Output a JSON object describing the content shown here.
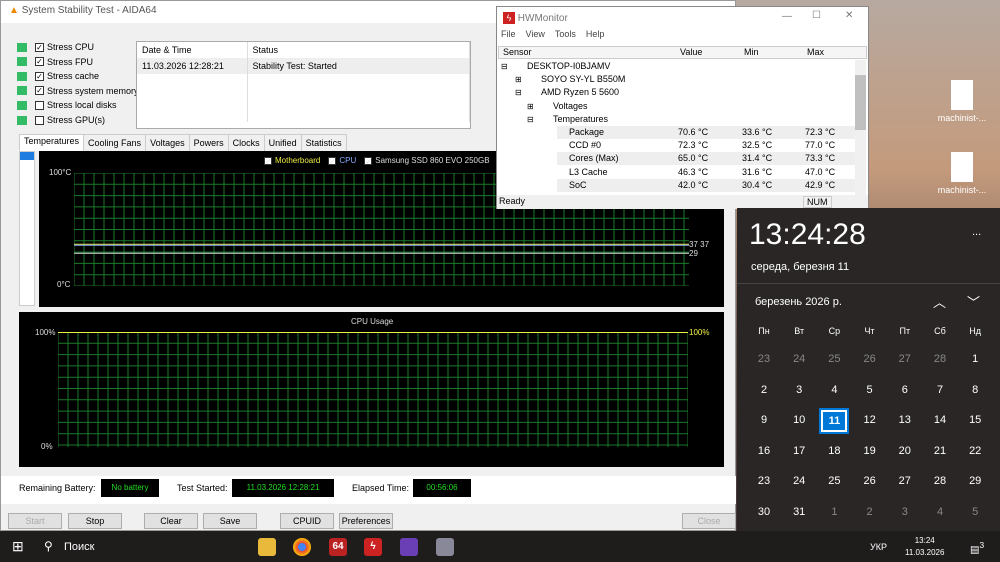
{
  "aida": {
    "title": "System Stability Test - AIDA64",
    "stress": [
      {
        "label": "Stress CPU",
        "checked": true
      },
      {
        "label": "Stress FPU",
        "checked": true
      },
      {
        "label": "Stress cache",
        "checked": true
      },
      {
        "label": "Stress system memory",
        "checked": true
      },
      {
        "label": "Stress local disks",
        "checked": false
      },
      {
        "label": "Stress GPU(s)",
        "checked": false
      }
    ],
    "log": {
      "headers": [
        "Date & Time",
        "Status"
      ],
      "rows": [
        [
          "11.03.2026 12:28:21",
          "Stability Test: Started"
        ]
      ]
    },
    "tabs": [
      "Temperatures",
      "Cooling Fans",
      "Voltages",
      "Powers",
      "Clocks",
      "Unified",
      "Statistics"
    ],
    "temp_graph": {
      "legend": [
        "Motherboard",
        "CPU",
        "Samsung SSD 860 EVO 250GB"
      ],
      "ymax_label": "100°C",
      "ymin_label": "0°C",
      "end_labels": [
        "37 37",
        "29"
      ],
      "series": [
        {
          "name": "Motherboard",
          "value": 37
        },
        {
          "name": "CPU",
          "value": 37
        },
        {
          "name": "Samsung SSD 860 EVO 250GB",
          "value": 29
        }
      ]
    },
    "cpu_graph": {
      "title": "CPU Usage",
      "ymax_label": "100%",
      "ymin_label": "0%",
      "right_label": "100%",
      "value": 100
    },
    "status": {
      "battery_label": "Remaining Battery:",
      "battery": "No battery",
      "started_label": "Test Started:",
      "started": "11.03.2026 12:28:21",
      "elapsed_label": "Elapsed Time:",
      "elapsed": "00:56:06"
    },
    "buttons": {
      "start": "Start",
      "stop": "Stop",
      "clear": "Clear",
      "save": "Save",
      "cpuid": "CPUID",
      "preferences": "Preferences",
      "close": "Close"
    }
  },
  "hwm": {
    "title": "HWMonitor",
    "menu": [
      "File",
      "View",
      "Tools",
      "Help"
    ],
    "headers": [
      "Sensor",
      "Value",
      "Min",
      "Max"
    ],
    "tree": [
      "DESKTOP-I0BJAMV",
      "SOYO SY-YL B550M",
      "AMD Ryzen 5 5600",
      "Voltages",
      "Temperatures"
    ],
    "rows": [
      [
        "Package",
        "70.6 °C",
        "33.6 °C",
        "72.3 °C"
      ],
      [
        "CCD #0",
        "72.3 °C",
        "32.5 °C",
        "77.0 °C"
      ],
      [
        "Cores (Max)",
        "65.0 °C",
        "31.4 °C",
        "73.3 °C"
      ],
      [
        "L3 Cache",
        "46.3 °C",
        "31.6 °C",
        "47.0 °C"
      ],
      [
        "SoC",
        "42.0 °C",
        "30.4 °C",
        "42.9 °C"
      ]
    ],
    "status": "Ready",
    "num": "NUM"
  },
  "desktop": {
    "icons": [
      "machinist-...",
      "machinist-..."
    ]
  },
  "clock": {
    "time": "13:24:28",
    "date": "середа, березня 11",
    "month": "березень 2026 р.",
    "more": "...",
    "weekdays": [
      "Пн",
      "Вт",
      "Ср",
      "Чт",
      "Пт",
      "Сб",
      "Нд"
    ],
    "days": [
      "23",
      "24",
      "25",
      "26",
      "27",
      "28",
      "1",
      "2",
      "3",
      "4",
      "5",
      "6",
      "7",
      "8",
      "9",
      "10",
      "11",
      "12",
      "13",
      "14",
      "15",
      "16",
      "17",
      "18",
      "19",
      "20",
      "21",
      "22",
      "23",
      "24",
      "25",
      "26",
      "27",
      "28",
      "29",
      "30",
      "31",
      "1",
      "2",
      "3",
      "4",
      "5"
    ],
    "today": "11"
  },
  "taskbar": {
    "search": "Поиск",
    "lang": "УКР",
    "time": "13:24",
    "date": "11.03.2026",
    "notif": "3",
    "apps": [
      "64"
    ]
  }
}
